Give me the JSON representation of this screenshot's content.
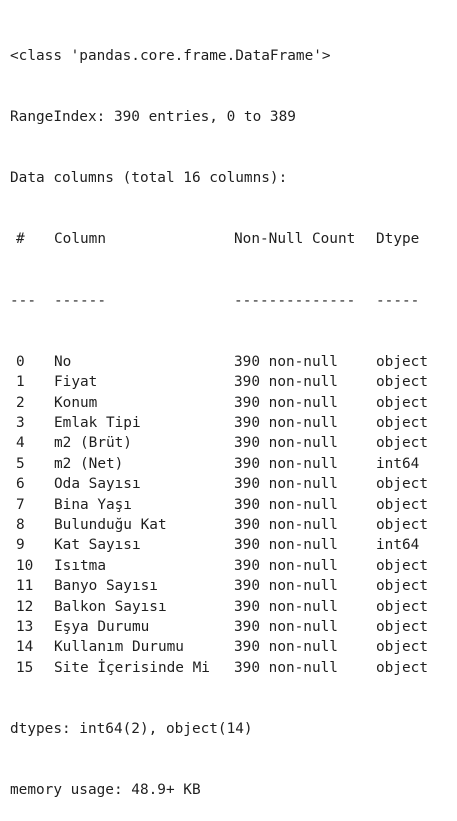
{
  "info": {
    "class_line": "<class 'pandas.core.frame.DataFrame'>",
    "range_index": "RangeIndex: 390 entries, 0 to 389",
    "data_columns": "Data columns (total 16 columns):",
    "header": {
      "num": "#",
      "column": "Column",
      "non_null": "Non-Null Count",
      "dtype": "Dtype"
    },
    "separator": {
      "num": "---",
      "column": "------",
      "non_null": "--------------",
      "dtype": "-----"
    },
    "rows": [
      {
        "num": "0",
        "column": "No",
        "non_null": "390 non-null",
        "dtype": "object"
      },
      {
        "num": "1",
        "column": "Fiyat",
        "non_null": "390 non-null",
        "dtype": "object"
      },
      {
        "num": "2",
        "column": "Konum",
        "non_null": "390 non-null",
        "dtype": "object"
      },
      {
        "num": "3",
        "column": "Emlak Tipi",
        "non_null": "390 non-null",
        "dtype": "object"
      },
      {
        "num": "4",
        "column": "m2 (Brüt)",
        "non_null": "390 non-null",
        "dtype": "object"
      },
      {
        "num": "5",
        "column": "m2 (Net)",
        "non_null": "390 non-null",
        "dtype": "int64"
      },
      {
        "num": "6",
        "column": "Oda Sayısı",
        "non_null": "390 non-null",
        "dtype": "object"
      },
      {
        "num": "7",
        "column": "Bina Yaşı",
        "non_null": "390 non-null",
        "dtype": "object"
      },
      {
        "num": "8",
        "column": "Bulunduğu Kat",
        "non_null": "390 non-null",
        "dtype": "object"
      },
      {
        "num": "9",
        "column": "Kat Sayısı",
        "non_null": "390 non-null",
        "dtype": "int64"
      },
      {
        "num": "10",
        "column": "Isıtma",
        "non_null": "390 non-null",
        "dtype": "object"
      },
      {
        "num": "11",
        "column": "Banyo Sayısı",
        "non_null": "390 non-null",
        "dtype": "object"
      },
      {
        "num": "12",
        "column": "Balkon Sayısı",
        "non_null": "390 non-null",
        "dtype": "object"
      },
      {
        "num": "13",
        "column": "Eşya Durumu",
        "non_null": "390 non-null",
        "dtype": "object"
      },
      {
        "num": "14",
        "column": "Kullanım Durumu",
        "non_null": "390 non-null",
        "dtype": "object"
      },
      {
        "num": "15",
        "column": "Site İçerisinde Mi",
        "non_null": "390 non-null",
        "dtype": "object"
      }
    ],
    "dtypes_line": "dtypes: int64(2), object(14)",
    "memory_line": "memory usage: 48.9+ KB"
  }
}
